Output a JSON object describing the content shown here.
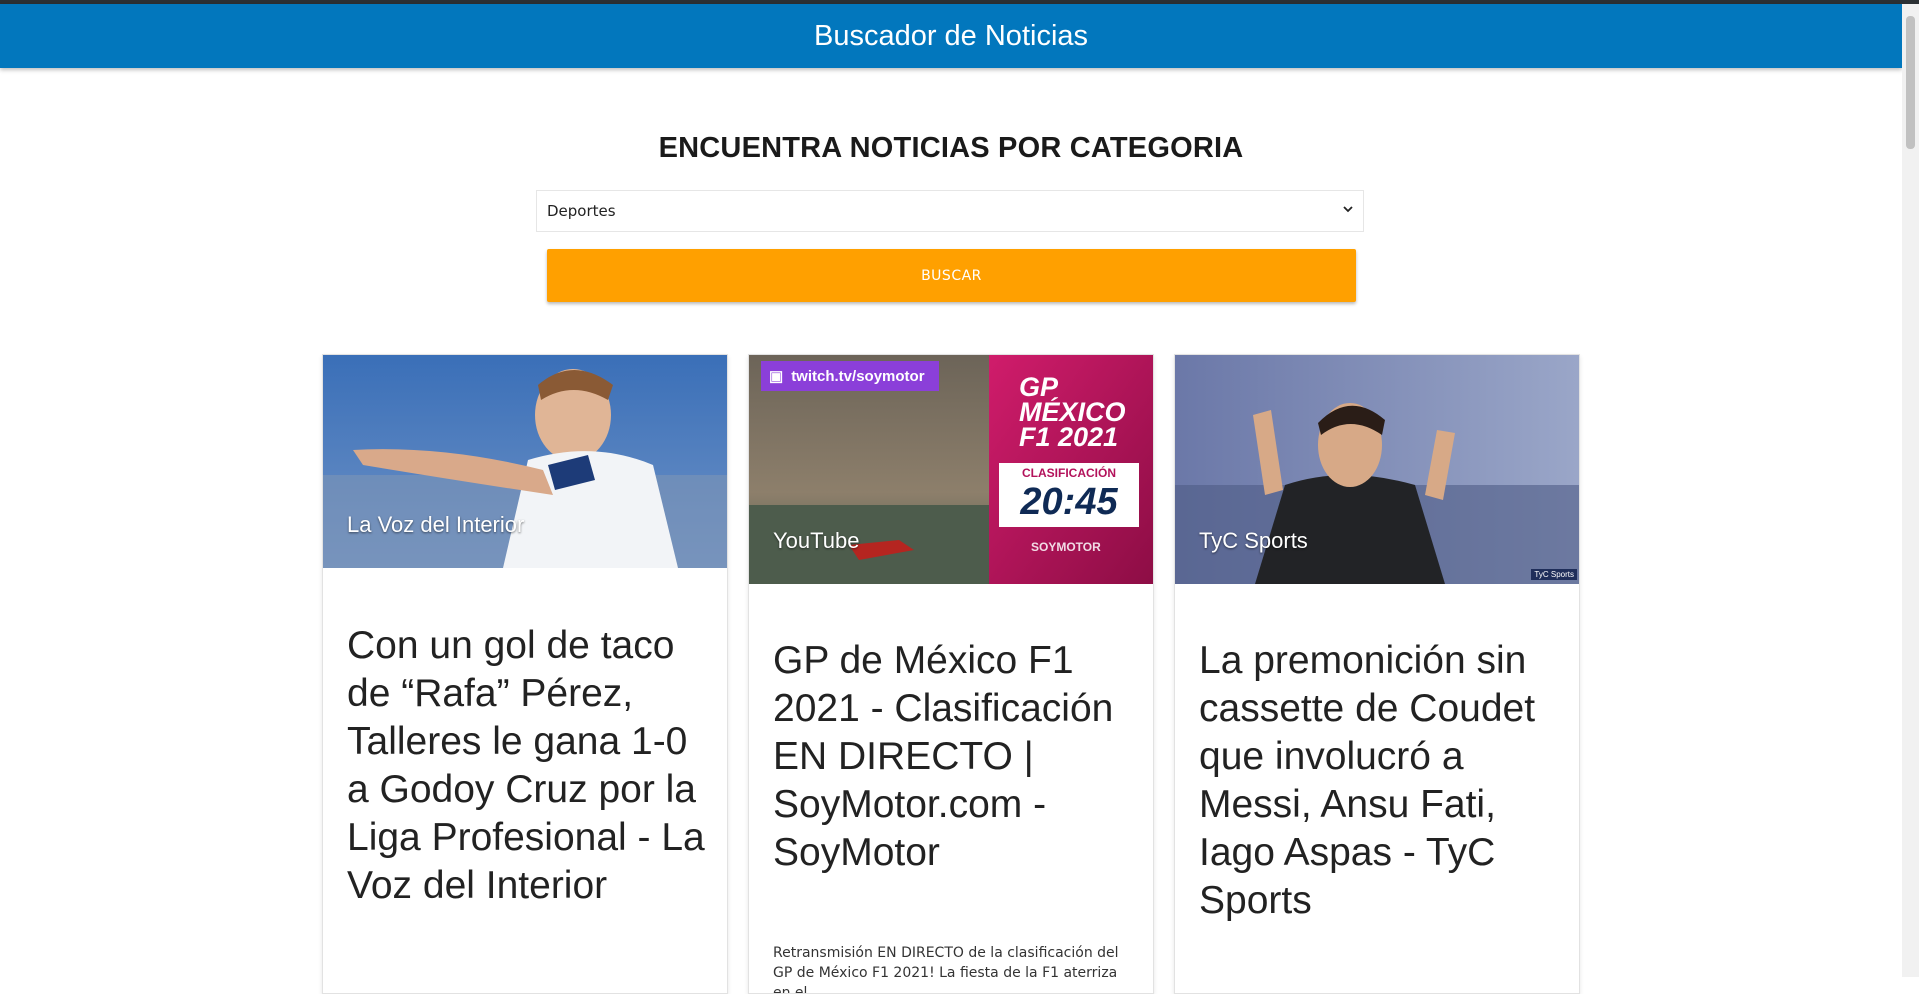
{
  "app": {
    "title": "Buscador de Noticias"
  },
  "search": {
    "heading": "ENCUENTRA NOTICIAS POR CATEGORIA",
    "selected_category": "Deportes",
    "button_label": "BUSCAR"
  },
  "news": [
    {
      "source": "La Voz del Interior",
      "title": "Con un gol de taco de “Rafa” Pérez, Talleres le gana 1-0 a Godoy Cruz por la Liga Profesional - La Voz del Interior"
    },
    {
      "source": "YouTube",
      "image_text": {
        "channel": "twitch.tv/soymotor",
        "gp_line1": "GP",
        "gp_line2": "MÉXICO",
        "gp_line3": "F1 2021",
        "session": "CLASIFICACIÓN",
        "time": "20:45",
        "brand": "SOYMOTOR"
      },
      "title": "GP de México F1 2021 - Clasificación EN DIRECTO | SoyMotor.com - SoyMotor",
      "description": "Retransmisión EN DIRECTO de la clasificación del GP de México F1 2021! La fiesta de la F1 aterriza en el"
    },
    {
      "source": "TyC Sports",
      "image_text": {
        "watermark": "TyC Sports"
      },
      "title": "La premonición sin cassette de Coudet que involucró a Messi, Ansu Fati, Iago Aspas - TyC Sports"
    }
  ]
}
